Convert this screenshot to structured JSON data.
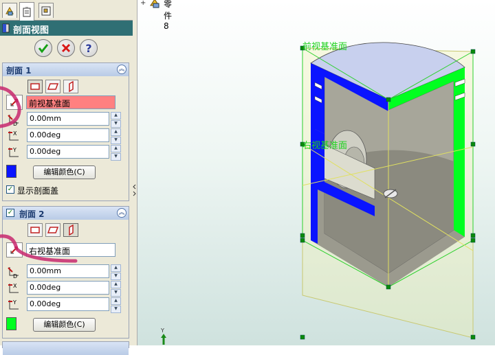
{
  "feature_manager": {
    "tabs": [
      "feature-tree-tab",
      "property-manager-tab",
      "configuration-manager-tab"
    ],
    "title": "剖面视图",
    "ok_icon": "check-icon",
    "cancel_icon": "x-icon",
    "help_icon": "question-icon"
  },
  "section1": {
    "title": "剖面 1",
    "reference": "前视基准面",
    "offset": "0.00mm",
    "rot_x": "0.00deg",
    "rot_y": "0.00deg",
    "color": "#0a14ff",
    "edit_color_label": "编辑颜色(C)",
    "show_cap_label": "显示剖面盖",
    "show_cap_checked": true,
    "offset_axis": "D",
    "x_axis": "X",
    "y_axis": "Y"
  },
  "section2": {
    "title": "剖面 2",
    "enabled": true,
    "reference": "右视基准面",
    "offset": "0.00mm",
    "rot_x": "0.00deg",
    "rot_y": "0.00deg",
    "color": "#00ff20",
    "edit_color_label": "编辑颜色(C)",
    "offset_axis": "D",
    "x_axis": "X",
    "y_axis": "Y"
  },
  "graphics": {
    "tree_label": "零件8",
    "plane_front_label": "前视基准面",
    "plane_right_label": "右视基准面",
    "triad_y": "Y"
  }
}
